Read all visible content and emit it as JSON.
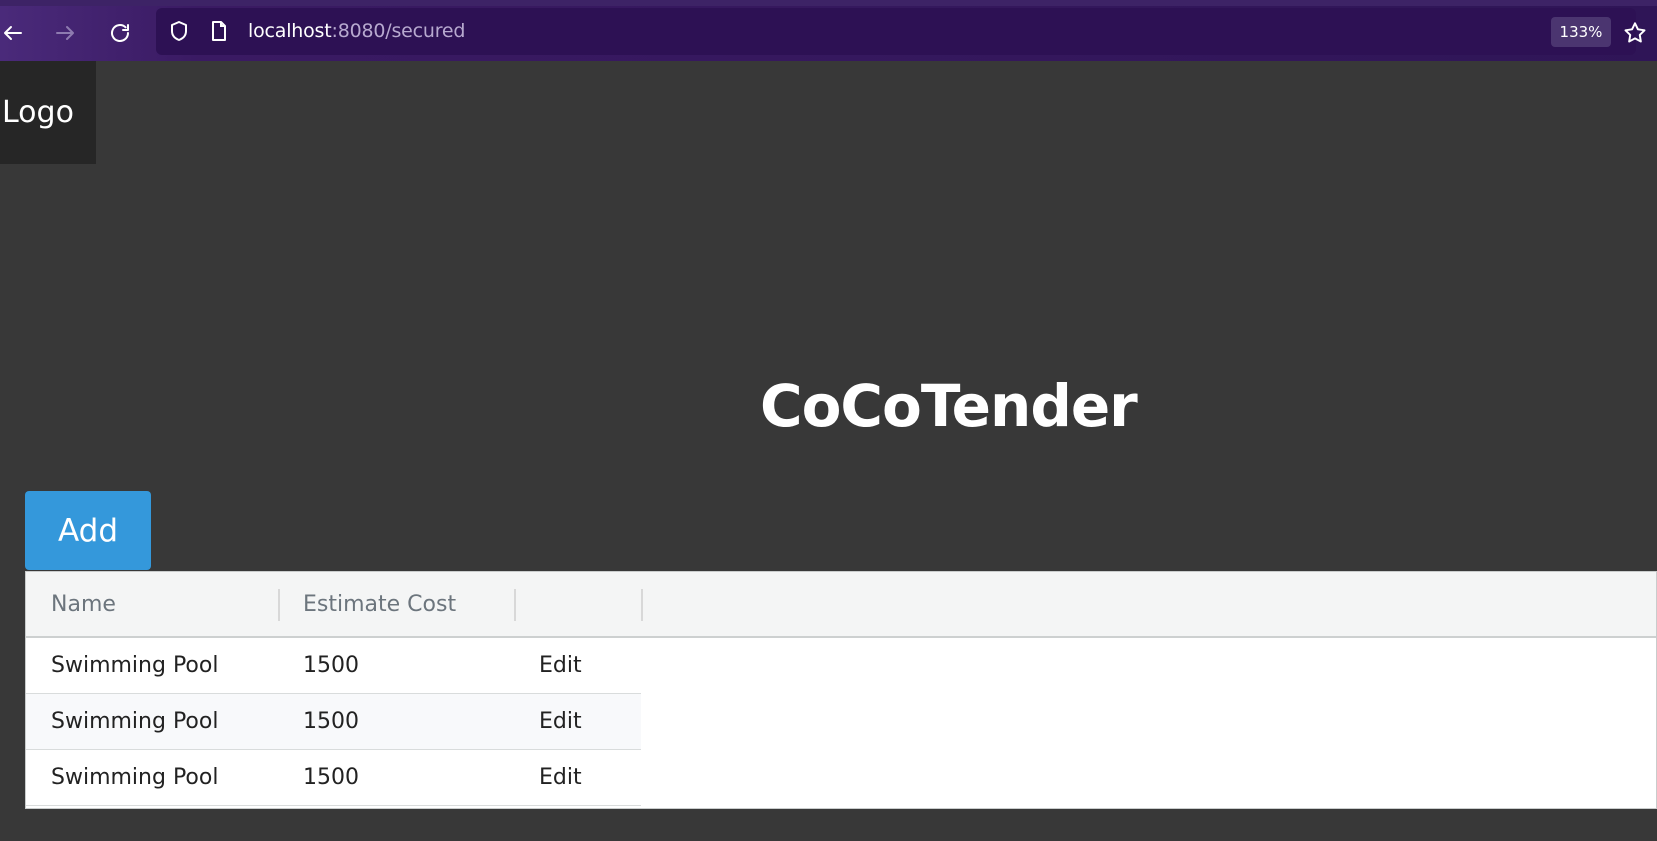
{
  "browser": {
    "url_host": "localhost",
    "url_path": ":8080/secured",
    "zoom": "133%"
  },
  "header": {
    "logo": "Logo"
  },
  "main": {
    "title": "CoCoTender",
    "add_label": "Add"
  },
  "table": {
    "columns": [
      "Name",
      "Estimate Cost",
      ""
    ],
    "rows": [
      {
        "name": "Swimming Pool",
        "cost": "1500",
        "action": "Edit"
      },
      {
        "name": "Swimming Pool",
        "cost": "1500",
        "action": "Edit"
      },
      {
        "name": "Swimming Pool",
        "cost": "1500",
        "action": "Edit"
      }
    ]
  },
  "colors": {
    "page_bg": "#383838",
    "logo_bg": "#262626",
    "accent": "#3498db",
    "browser_bar": "#2f1557"
  }
}
